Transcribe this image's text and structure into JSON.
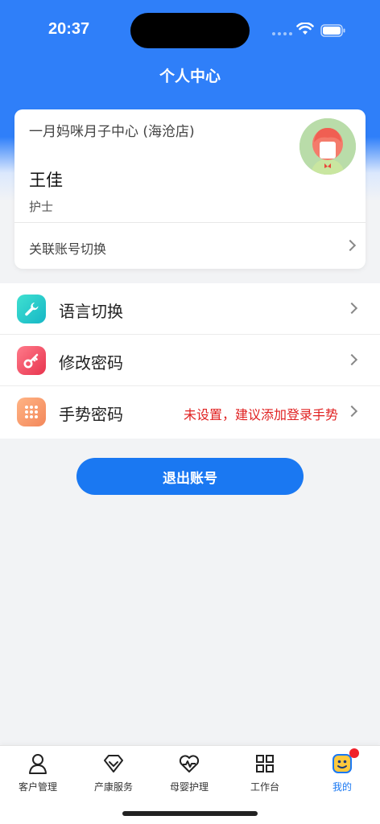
{
  "status_bar": {
    "time": "20:37"
  },
  "page": {
    "title": "个人中心"
  },
  "profile": {
    "store_name": "一月妈咪月子中心 (海沧店)",
    "user_name": "王佳",
    "role": "护士",
    "switch_account_label": "关联账号切换"
  },
  "menu": {
    "items": [
      {
        "label": "语言切换",
        "icon": "wrench-icon",
        "color": "#1ec9c4"
      },
      {
        "label": "修改密码",
        "icon": "key-icon",
        "color": "#f2536a"
      },
      {
        "label": "手势密码",
        "icon": "gesture-grid-icon",
        "color": "#f79a6a",
        "hint": "未设置，建议添加登录手势"
      }
    ]
  },
  "logout": {
    "label": "退出账号"
  },
  "tabbar": {
    "tabs": [
      {
        "label": "客户管理",
        "icon": "person-icon"
      },
      {
        "label": "产康服务",
        "icon": "diamond-heart-icon"
      },
      {
        "label": "母婴护理",
        "icon": "heartbeat-icon"
      },
      {
        "label": "工作台",
        "icon": "grid-icon"
      },
      {
        "label": "我的",
        "icon": "smiley-icon",
        "active": true
      }
    ]
  },
  "colors": {
    "primary": "#1a78f2",
    "warning_text": "#e02020",
    "badge": "#f0202a"
  }
}
